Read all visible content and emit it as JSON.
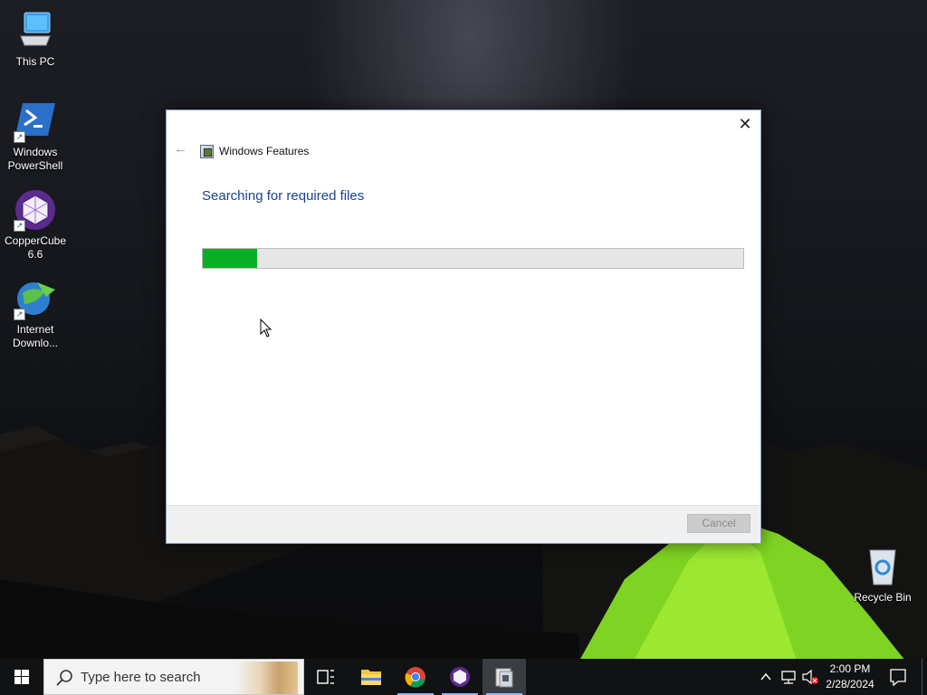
{
  "desktop": {
    "icons": [
      {
        "label": "This PC",
        "icon": "this-pc-icon"
      },
      {
        "label": "Windows PowerShell",
        "icon": "powershell-icon"
      },
      {
        "label": "CopperCube 6.6",
        "icon": "coppercube-icon"
      },
      {
        "label": "Internet Downlo...",
        "icon": "internet-download-manager-icon"
      },
      {
        "label": "Recycle Bin",
        "icon": "recycle-bin-icon"
      }
    ]
  },
  "dialog": {
    "title": "Windows Features",
    "heading": "Searching for required files",
    "progress": 0.1,
    "cancel_label": "Cancel",
    "progress_color": "#06b025",
    "heading_color": "#1c3f8c"
  },
  "taskbar": {
    "search_placeholder": "Type here to search",
    "apps": [
      "task-view-icon",
      "file-explorer-icon",
      "chrome-icon",
      "coppercube-icon",
      "windows-features-icon"
    ],
    "time": "2:00 PM",
    "date": "2/28/2024"
  }
}
